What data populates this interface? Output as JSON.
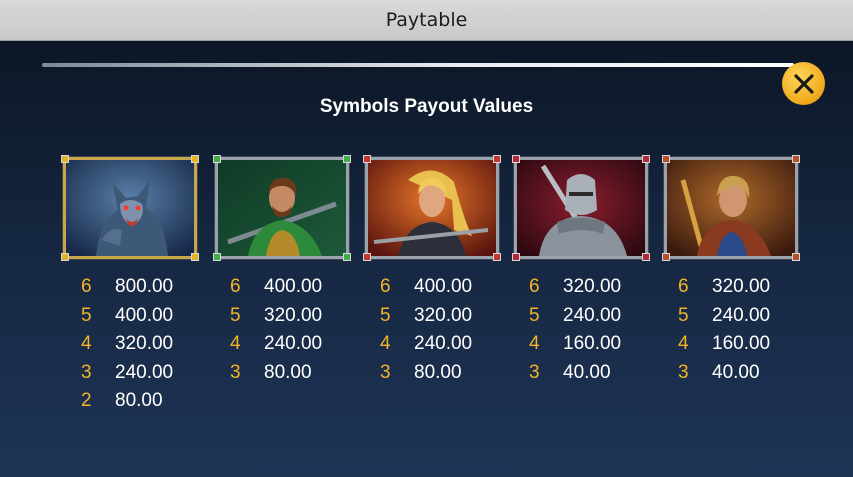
{
  "header": {
    "title": "Paytable"
  },
  "close_icon": "close-icon",
  "page": {
    "heading": "Symbols Payout Values"
  },
  "symbols": [
    {
      "name": "werewolf",
      "accent": "#e3b42a",
      "payouts": [
        {
          "count": "6",
          "value": "800.00"
        },
        {
          "count": "5",
          "value": "400.00"
        },
        {
          "count": "4",
          "value": "320.00"
        },
        {
          "count": "3",
          "value": "240.00"
        },
        {
          "count": "2",
          "value": "80.00"
        }
      ]
    },
    {
      "name": "green-archer",
      "accent": "#3fae45",
      "payouts": [
        {
          "count": "6",
          "value": "400.00"
        },
        {
          "count": "5",
          "value": "320.00"
        },
        {
          "count": "4",
          "value": "240.00"
        },
        {
          "count": "3",
          "value": "80.00"
        }
      ]
    },
    {
      "name": "blonde-warrior",
      "accent": "#c0392b",
      "payouts": [
        {
          "count": "6",
          "value": "400.00"
        },
        {
          "count": "5",
          "value": "320.00"
        },
        {
          "count": "4",
          "value": "240.00"
        },
        {
          "count": "3",
          "value": "80.00"
        }
      ]
    },
    {
      "name": "armored-knight",
      "accent": "#b02a3a",
      "payouts": [
        {
          "count": "6",
          "value": "320.00"
        },
        {
          "count": "5",
          "value": "240.00"
        },
        {
          "count": "4",
          "value": "160.00"
        },
        {
          "count": "3",
          "value": "40.00"
        }
      ]
    },
    {
      "name": "old-warrior",
      "accent": "#b5502a",
      "payouts": [
        {
          "count": "6",
          "value": "320.00"
        },
        {
          "count": "5",
          "value": "240.00"
        },
        {
          "count": "4",
          "value": "160.00"
        },
        {
          "count": "3",
          "value": "40.00"
        }
      ]
    }
  ]
}
